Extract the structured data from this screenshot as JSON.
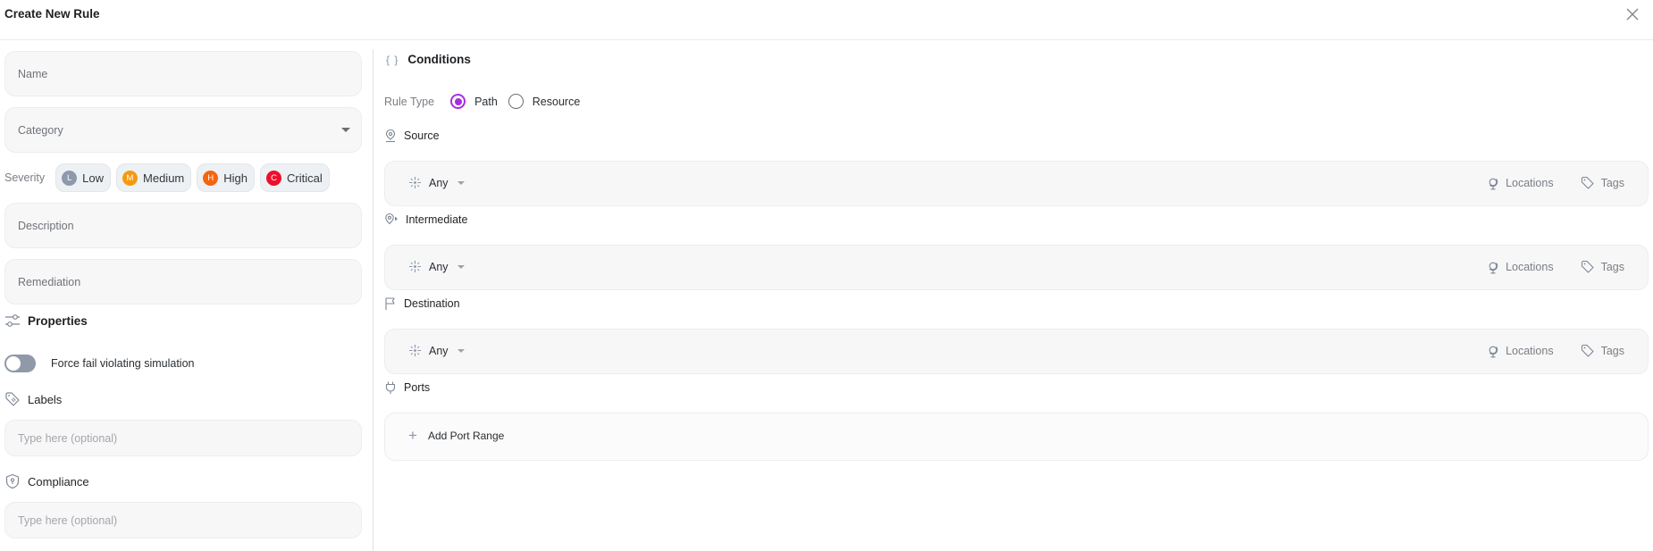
{
  "header": {
    "title": "Create New Rule",
    "close_icon": "close-icon"
  },
  "left": {
    "name_placeholder": "Name",
    "category_placeholder": "Category",
    "severity": {
      "label": "Severity",
      "options": [
        {
          "letter": "L",
          "label": "Low",
          "color": "#8e99ab"
        },
        {
          "letter": "M",
          "label": "Medium",
          "color": "#f59a0e"
        },
        {
          "letter": "H",
          "label": "High",
          "color": "#f4650f"
        },
        {
          "letter": "C",
          "label": "Critical",
          "color": "#ef0f2c"
        }
      ]
    },
    "description_placeholder": "Description",
    "remediation_placeholder": "Remediation",
    "properties": {
      "title": "Properties",
      "toggle_label": "Force fail violating simulation",
      "toggle_on": false
    },
    "labels": {
      "title": "Labels",
      "placeholder": "Type here (optional)"
    },
    "compliance": {
      "title": "Compliance",
      "placeholder": "Type here (optional)"
    }
  },
  "conditions": {
    "braces": "{ }",
    "title": "Conditions",
    "rule_type": {
      "label": "Rule Type",
      "options": [
        "Path",
        "Resource"
      ],
      "selected": "Path",
      "accent": "#a72ee0"
    },
    "source": {
      "title": "Source",
      "value": "Any",
      "locations": "Locations",
      "tags": "Tags"
    },
    "intermediate": {
      "title": "Intermediate",
      "value": "Any",
      "locations": "Locations",
      "tags": "Tags"
    },
    "destination": {
      "title": "Destination",
      "value": "Any",
      "locations": "Locations",
      "tags": "Tags"
    },
    "ports": {
      "title": "Ports",
      "add_label": "Add Port Range",
      "plus": "+"
    }
  }
}
